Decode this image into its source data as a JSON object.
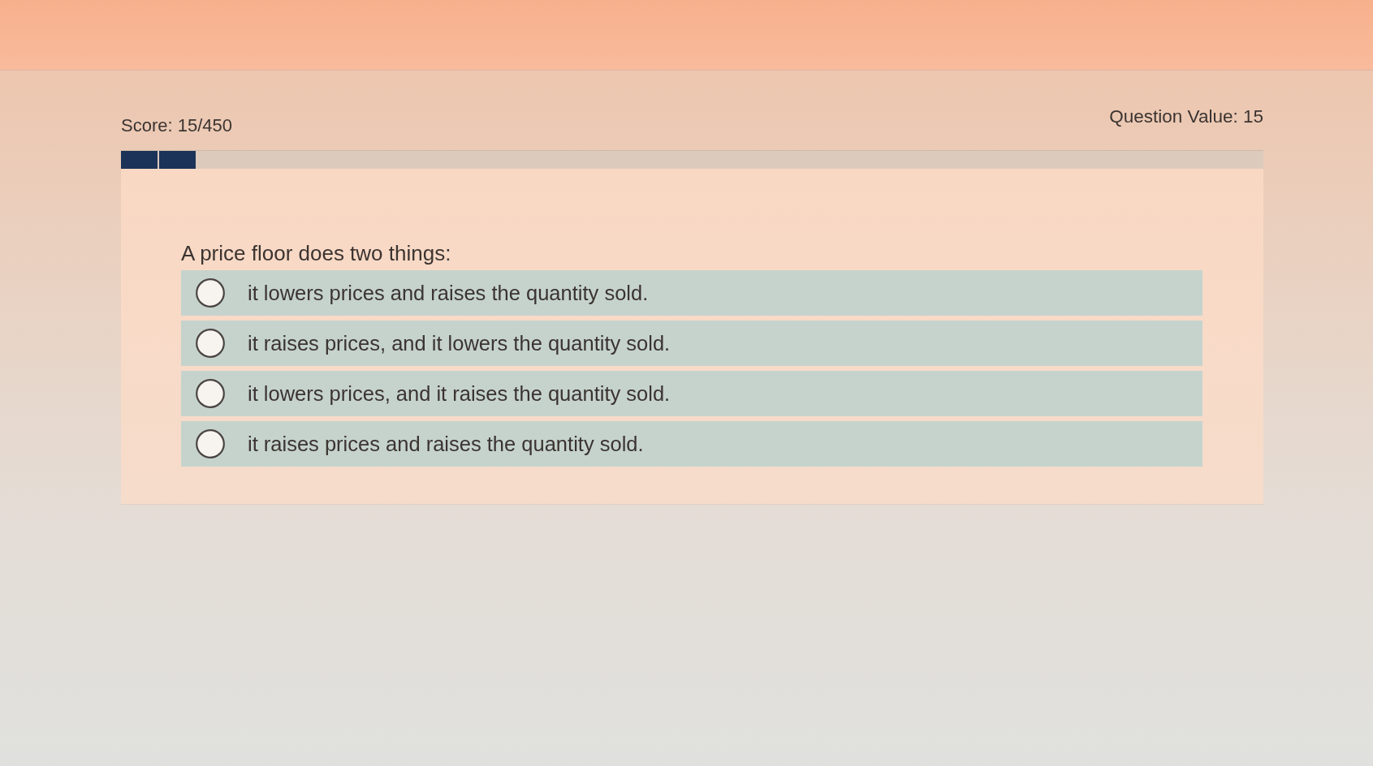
{
  "header": {
    "score": "Score: 15/450",
    "question_value": "Question Value: 15"
  },
  "progress": {
    "level": 0.067
  },
  "question": {
    "prompt": "A price floor does two things:",
    "options": [
      {
        "label": "it lowers prices and raises the quantity sold.",
        "selected": false
      },
      {
        "label": "it raises prices, and it lowers the quantity sold.",
        "selected": false
      },
      {
        "label": "it lowers prices, and it raises the quantity sold.",
        "selected": false
      },
      {
        "label": "it raises prices and raises the quantity sold.",
        "selected": false
      }
    ]
  }
}
